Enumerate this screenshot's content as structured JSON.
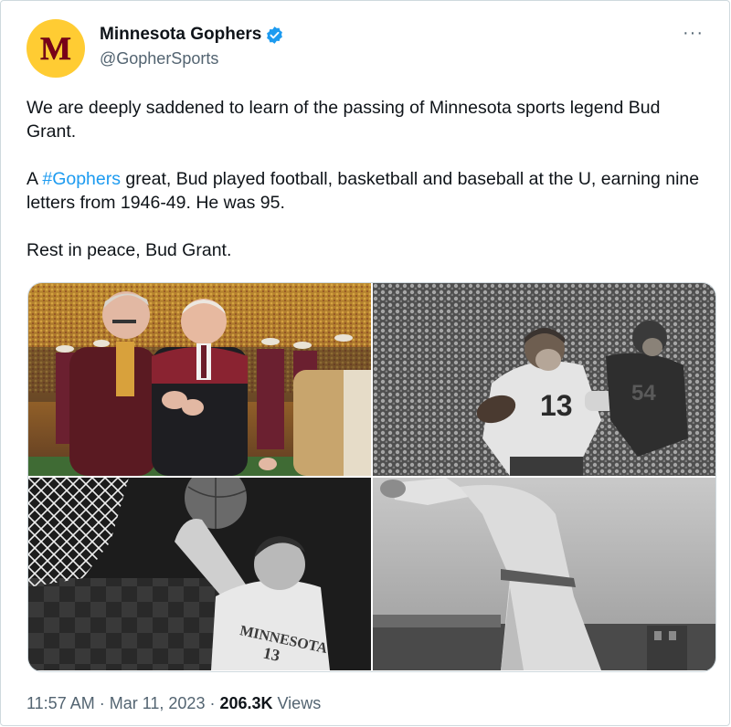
{
  "account": {
    "display_name": "Minnesota Gophers",
    "handle": "@GopherSports",
    "verified": true,
    "avatar_letter": "M",
    "avatar_color": "#ffcc33",
    "avatar_letter_color": "#7a0019"
  },
  "menu": {
    "more_label": "···"
  },
  "tweet": {
    "paragraph1": "We are deeply saddened to learn of the passing of  Minnesota sports legend Bud Grant.",
    "paragraph2_prefix": "A ",
    "hashtag": "#Gophers",
    "paragraph2_suffix": " great, Bud played football, basketball and baseball at the U, earning nine letters from 1946-49. He was 95.",
    "paragraph3": "Rest in peace, Bud Grant."
  },
  "media": {
    "photos": [
      {
        "name": "photo-stadium-ceremony"
      },
      {
        "name": "photo-football-player",
        "jersey": "13"
      },
      {
        "name": "photo-basketball-player",
        "jersey_text": "MINNESOTA",
        "jersey_number": "13"
      },
      {
        "name": "photo-baseball-player"
      }
    ]
  },
  "meta": {
    "time": "11:57 AM",
    "separator": " · ",
    "date": "Mar 11, 2023",
    "views_count": "206.3K",
    "views_label": " Views"
  },
  "colors": {
    "link": "#1d9bf0",
    "secondary_text": "#536471",
    "border": "#cfd9de"
  }
}
